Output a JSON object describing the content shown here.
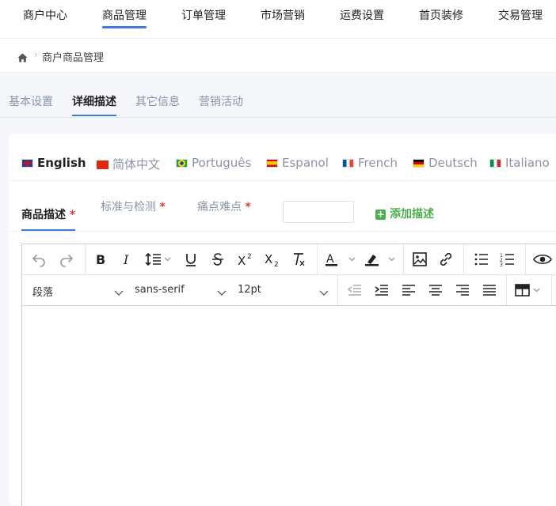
{
  "top_nav": [
    "商户中心",
    "商品管理",
    "订单管理",
    "市场营销",
    "运费设置",
    "首页装修",
    "交易管理"
  ],
  "breadcrumb": "商户商品管理",
  "tabs": [
    "基本设置",
    "详细描述",
    "其它信息",
    "营销活动"
  ],
  "languages": [
    "English",
    "简体中文",
    "Português",
    "Espanol",
    "French",
    "Deutsch",
    "Italiano"
  ],
  "desc_tabs": [
    {
      "label": "商品描述",
      "required": "*"
    },
    {
      "label": "标准与检测",
      "required": "*"
    },
    {
      "label": "痛点难点",
      "required": "*"
    }
  ],
  "desc_input": "",
  "add_desc_label": "添加描述",
  "editor": {
    "block_format": "段落",
    "font_family": "sans-serif",
    "font_size": "12pt"
  },
  "colors": {
    "accent": "#3f7bd6",
    "success": "#4cae4c",
    "required": "#e03a3a"
  }
}
